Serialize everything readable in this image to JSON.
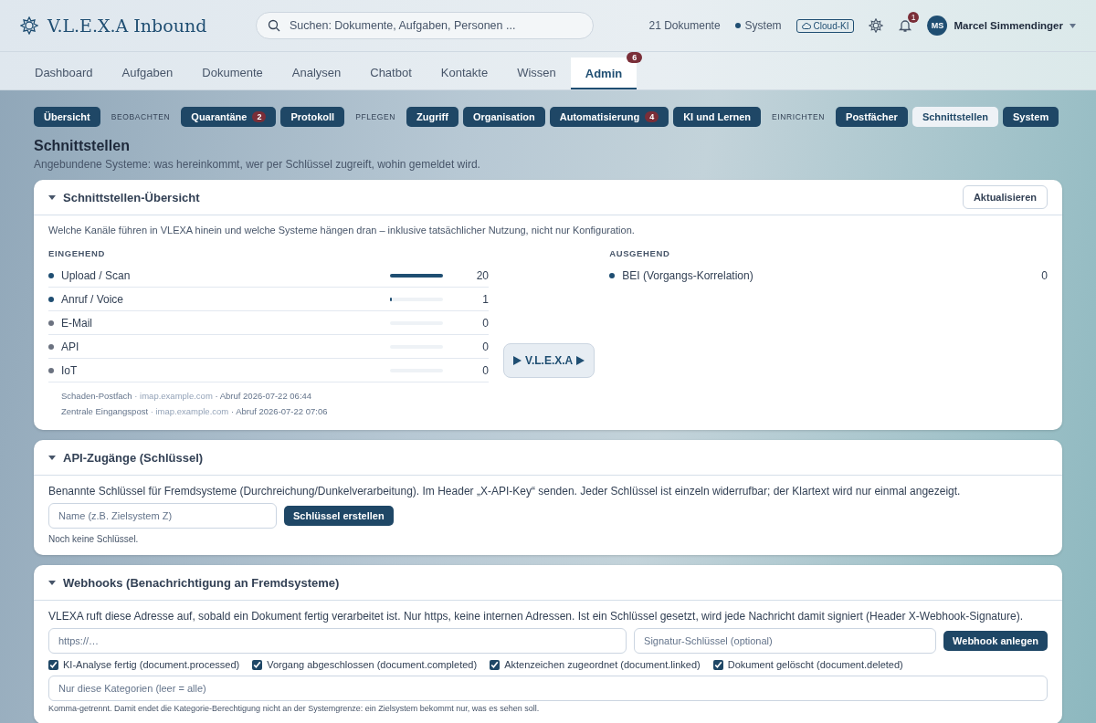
{
  "header": {
    "brand": "V.L.E.X.A Inbound",
    "search": {
      "placeholder": "Suchen: Dokumente, Aufgaben, Personen ..."
    },
    "doc_count": "21 Dokumente",
    "system": "System",
    "cloud": "Cloud-KI",
    "notifications": "1",
    "user": {
      "initials": "MS",
      "name": "Marcel Simmendinger"
    }
  },
  "tabs": [
    {
      "label": "Dashboard",
      "selected": false
    },
    {
      "label": "Aufgaben",
      "selected": false
    },
    {
      "label": "Dokumente",
      "selected": false
    },
    {
      "label": "Analysen",
      "selected": false
    },
    {
      "label": "Chatbot",
      "selected": false
    },
    {
      "label": "Kontakte",
      "selected": false
    },
    {
      "label": "Wissen",
      "selected": false
    },
    {
      "label": "Admin",
      "selected": true,
      "badge": "6"
    }
  ],
  "subnav": [
    {
      "kind": "link",
      "label": "Übersicht",
      "selected": false
    },
    {
      "kind": "section",
      "label": "BEOBACHTEN"
    },
    {
      "kind": "link",
      "label": "Quarantäne",
      "selected": false,
      "badge": "2"
    },
    {
      "kind": "link",
      "label": "Protokoll",
      "selected": false
    },
    {
      "kind": "section",
      "label": "PFLEGEN"
    },
    {
      "kind": "link",
      "label": "Zugriff",
      "selected": false
    },
    {
      "kind": "link",
      "label": "Organisation",
      "selected": false
    },
    {
      "kind": "link",
      "label": "Automatisierung",
      "selected": false,
      "badge": "4"
    },
    {
      "kind": "link",
      "label": "KI und Lernen",
      "selected": false
    },
    {
      "kind": "section",
      "label": "EINRICHTEN"
    },
    {
      "kind": "link",
      "label": "Postfächer",
      "selected": false
    },
    {
      "kind": "link",
      "label": "Schnittstellen",
      "selected": true
    },
    {
      "kind": "link",
      "label": "System",
      "selected": false
    }
  ],
  "page": {
    "title": "Schnittstellen",
    "subtitle": "Angebundene Systeme: was hereinkommt, wer per Schlüssel zugreift, wohin gemeldet wird."
  },
  "overview": {
    "title": "Schnittstellen-Übersicht",
    "expanded": true,
    "refresh": "Aktualisieren",
    "intro": "Welche Kanäle führen in VLEXA hinein und welche Systeme hängen dran – inklusive tatsächlicher Nutzung, nicht nur Konfiguration.",
    "incoming_label": "EINGEHEND",
    "outgoing_label": "AUSGEHEND",
    "incoming": [
      {
        "name": "Upload / Scan",
        "color": "#1f4e72",
        "level": 1,
        "count": "20"
      },
      {
        "name": "Anruf / Voice",
        "color": "#1f4e72",
        "level": 0.04,
        "count": "1"
      },
      {
        "name": "E-Mail",
        "color": "#6b7280",
        "level": 0,
        "count": "0"
      },
      {
        "name": "API",
        "color": "#6b7280",
        "level": 0,
        "count": "0"
      },
      {
        "name": "IoT",
        "color": "#6b7280",
        "level": 0,
        "count": "0"
      }
    ],
    "mailboxes": [
      {
        "name": "Schaden-Postfach",
        "host": "· imap.example.com",
        "fetch": "· Abruf 2026-07-22 06:44"
      },
      {
        "name": "Zentrale Eingangspost",
        "host": "· imap.example.com",
        "fetch": "· Abruf 2026-07-22 07:06"
      }
    ],
    "hub": "V.L.E.X.A",
    "outgoing": [
      {
        "name": "BEI (Vorgangs-Korrelation)",
        "color": "#1f4e72",
        "count": "0"
      }
    ]
  },
  "api": {
    "title": "API-Zugänge (Schlüssel)",
    "expanded": true,
    "intro": "Benannte Schlüssel für Fremdsysteme (Durchreichung/Dunkelverarbeitung). Im Header „X-API-Key“ senden. Jeder Schlüssel ist einzeln widerrufbar; der Klartext wird nur einmal angezeigt.",
    "name_field": {
      "placeholder": "Name (z.B. Zielsystem Z)"
    },
    "create": "Schlüssel erstellen",
    "empty": "Noch keine Schlüssel."
  },
  "webhooks": {
    "title": "Webhooks (Benachrichtigung an Fremdsysteme)",
    "expanded": true,
    "intro": "VLEXA ruft diese Adresse auf, sobald ein Dokument fertig verarbeitet ist. Nur https, keine internen Adressen. Ist ein Schlüssel gesetzt, wird jede Nachricht damit signiert (Header X-Webhook-Signature).",
    "url_field": {
      "placeholder": "https://…"
    },
    "secret_field": {
      "placeholder": "Signatur-Schlüssel (optional)"
    },
    "create": "Webhook anlegen",
    "events": [
      {
        "label": "KI-Analyse fertig (document.processed)",
        "checked": true
      },
      {
        "label": "Vorgang abgeschlossen (document.completed)",
        "checked": true
      },
      {
        "label": "Aktenzeichen zugeordnet (document.linked)",
        "checked": true
      },
      {
        "label": "Dokument gelöscht (document.deleted)",
        "checked": true
      }
    ],
    "category_field": {
      "placeholder": "Nur diese Kategorien (leer = alle)"
    },
    "hint": "Komma-getrennt. Damit endet die Kategorie-Berechtigung nicht an der Systemgrenze: ein Zielsystem bekommt nur, was es sehen soll."
  }
}
